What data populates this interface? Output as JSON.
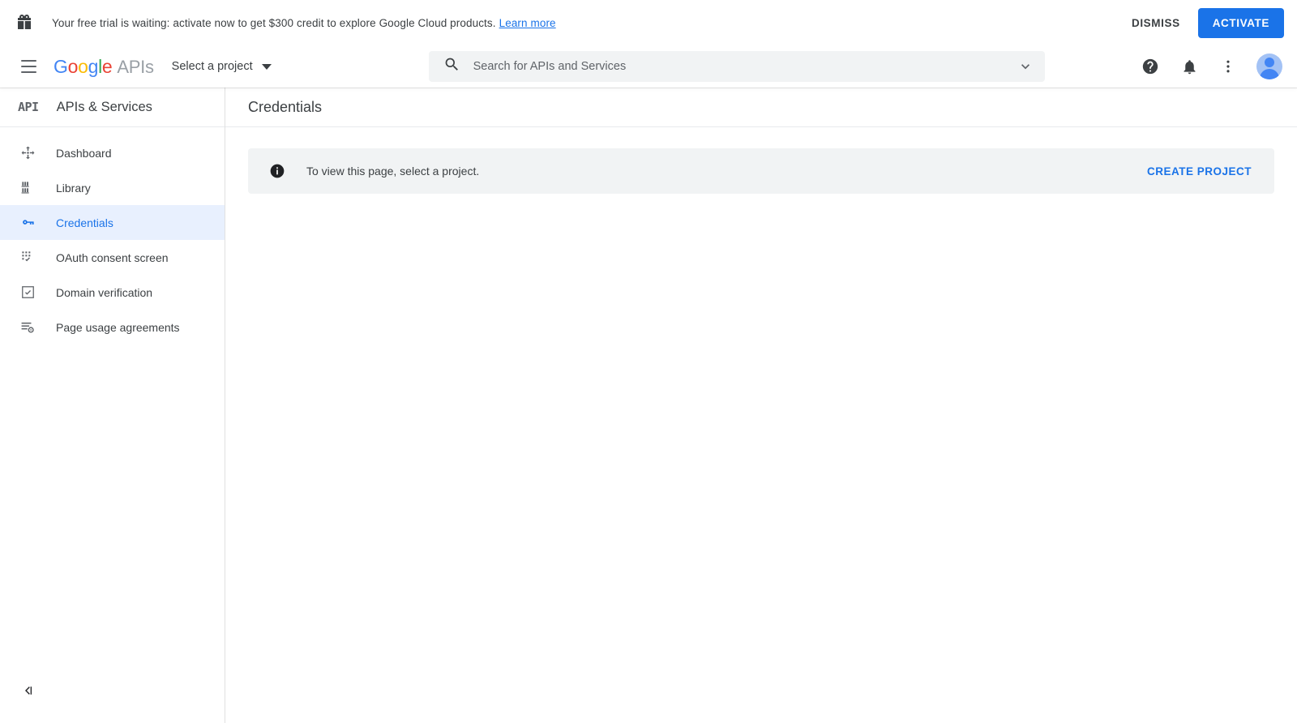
{
  "promo": {
    "icon": "gift-icon",
    "message": "Your free trial is waiting: activate now to get $300 credit to explore Google Cloud products.",
    "link_label": "Learn more",
    "dismiss_label": "DISMISS",
    "activate_label": "ACTIVATE",
    "activate_color": "#1a73e8"
  },
  "appbar": {
    "menu_icon": "hamburger-menu-icon",
    "brand": {
      "g": "G",
      "o1": "o",
      "o2": "o",
      "g2": "g",
      "l": "l",
      "e": "e",
      "suffix": "APIs"
    },
    "project_selector_label": "Select a project",
    "search": {
      "icon": "search-icon",
      "placeholder": "Search for APIs and Services",
      "value": "",
      "expand_icon": "chevron-down-icon"
    },
    "help_icon": "help-circle-icon",
    "notifications_icon": "bell-icon",
    "more_icon": "more-vertical-icon",
    "avatar_icon": "account-avatar"
  },
  "sidebar": {
    "badge": "API",
    "title": "APIs & Services",
    "items": [
      {
        "label": "Dashboard",
        "icon": "dashboard-icon",
        "active": false
      },
      {
        "label": "Library",
        "icon": "library-icon",
        "active": false
      },
      {
        "label": "Credentials",
        "icon": "key-icon",
        "active": true
      },
      {
        "label": "OAuth consent screen",
        "icon": "oauth-consent-icon",
        "active": false
      },
      {
        "label": "Domain verification",
        "icon": "domain-verification-icon",
        "active": false
      },
      {
        "label": "Page usage agreements",
        "icon": "page-usage-agreements-icon",
        "active": false
      }
    ],
    "collapse_icon": "collapse-panel-icon",
    "active_bg": "#e8f0fe",
    "active_fg": "#1a73e8"
  },
  "main": {
    "page_title": "Credentials",
    "notice": {
      "icon": "info-icon",
      "text": "To view this page, select a project.",
      "action_label": "CREATE PROJECT",
      "action_color": "#1a73e8",
      "background": "#f1f3f4"
    }
  }
}
